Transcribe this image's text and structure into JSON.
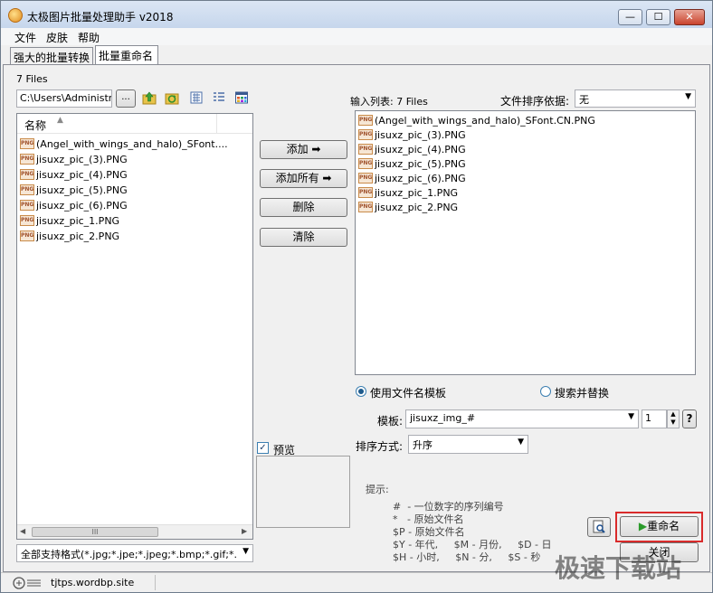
{
  "window": {
    "title": "太极图片批量处理助手  v2018",
    "minimize": "—",
    "maximize": "☐",
    "close": "✕"
  },
  "menu": [
    "文件",
    "皮肤",
    "帮助"
  ],
  "tabs": [
    "强大的批量转换",
    "批量重命名"
  ],
  "left": {
    "file_count": "7 Files",
    "path_value": "C:\\Users\\Administrat",
    "browse_label": "...",
    "column_header": "名称",
    "files": [
      "(Angel_with_wings_and_halo)_SFont....",
      "jisuxz_pic_(3).PNG",
      "jisuxz_pic_(4).PNG",
      "jisuxz_pic_(5).PNG",
      "jisuxz_pic_(6).PNG",
      "jisuxz_pic_1.PNG",
      "jisuxz_pic_2.PNG"
    ],
    "scroll_thumb": "III",
    "filter_value": "全部支持格式(*.jpg;*.jpe;*.jpeg;*.bmp;*.gif;*."
  },
  "middle": {
    "add": "添加 ➡",
    "add_all": "添加所有 ➡",
    "delete": "删除",
    "clear": "清除",
    "preview": "预览"
  },
  "right": {
    "input_list_label": "输入列表: 7 Files",
    "sort_label": "文件排序依据:",
    "sort_value": "无",
    "files": [
      "(Angel_with_wings_and_halo)_SFont.CN.PNG",
      "jisuxz_pic_(3).PNG",
      "jisuxz_pic_(4).PNG",
      "jisuxz_pic_(5).PNG",
      "jisuxz_pic_(6).PNG",
      "jisuxz_pic_1.PNG",
      "jisuxz_pic_2.PNG"
    ],
    "use_template": "使用文件名模板",
    "search_replace": "搜索并替换",
    "template_label": "模板:",
    "template_value": "jisuxz_img_#",
    "start_value": "1",
    "help": "?",
    "order_label": "排序方式:",
    "order_value": "升序",
    "hint_title": "提示:",
    "hints": [
      "#  - 一位数字的序列编号",
      "*   - 原始文件名",
      "$P - 原始文件名",
      "$Y - 年代,     $M - 月份,     $D - 日",
      "$H - 小时,     $N - 分,     $S - 秒"
    ],
    "rename": "重命名",
    "close": "关闭"
  },
  "status": {
    "text": "tjtps.wordbp.site"
  },
  "watermark": "极速下载站"
}
